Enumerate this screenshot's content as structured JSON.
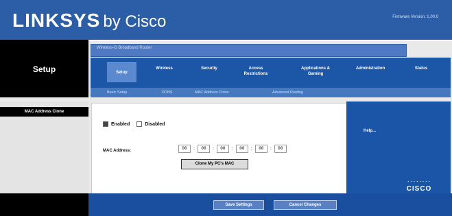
{
  "header": {
    "brand": "LINKSYS",
    "suffix": "by Cisco",
    "firmware": "Firmware Version: 1.00.0"
  },
  "section": {
    "title": "Setup"
  },
  "strip": {
    "text": "Wireless-G Broadband Router"
  },
  "nav": {
    "tabs": [
      {
        "label": "Setup",
        "active": true
      },
      {
        "label": "Wireless"
      },
      {
        "label": "Security"
      },
      {
        "label": "Access Restrictions"
      },
      {
        "label": "Applications & Gaming"
      },
      {
        "label": "Administration"
      },
      {
        "label": "Status"
      }
    ]
  },
  "subnav": {
    "items": [
      "Basic Setup",
      "DDNS",
      "MAC Address Clone",
      "Advanced Routing"
    ]
  },
  "leftnav": {
    "item": "MAC Address Clone"
  },
  "main": {
    "enabled_label": "Enabled",
    "disabled_label": "Disabled",
    "mac_label": "MAC Address:",
    "mac": [
      "00",
      "00",
      "00",
      "00",
      "00",
      "00"
    ],
    "clone_button": "Clone My PC's MAC"
  },
  "help": {
    "title": "Help..."
  },
  "footer": {
    "save": "Save Settings",
    "cancel": "Cancel Changes"
  },
  "cisco": {
    "bars": "········",
    "word": "CISCO"
  }
}
